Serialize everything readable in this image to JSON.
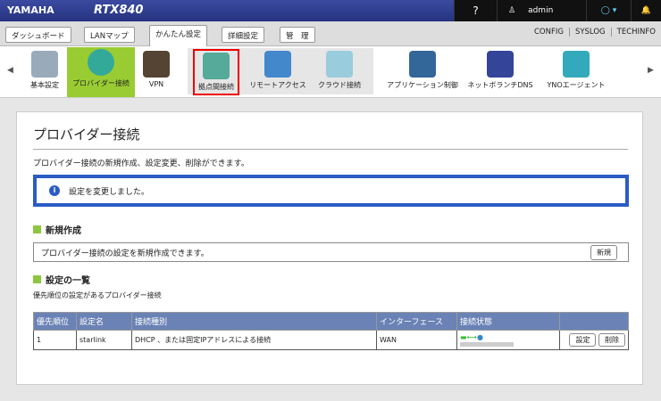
{
  "header": {
    "brand": "YAMAHA",
    "model": "RTX840",
    "help": "?",
    "user": "admin"
  },
  "tabs": [
    {
      "label": "ダッシュボード"
    },
    {
      "label": "LANマップ"
    },
    {
      "label": "かんたん設定"
    },
    {
      "label": "詳細設定"
    },
    {
      "label": "管　理"
    }
  ],
  "links": [
    "CONFIG",
    "SYSLOG",
    "TECHINFO"
  ],
  "menu": [
    {
      "label": "基本設定"
    },
    {
      "label": "プロバイダー接続"
    },
    {
      "label": "VPN"
    },
    {
      "label": "拠点間接続"
    },
    {
      "label": "リモートアクセス"
    },
    {
      "label": "クラウド接続"
    },
    {
      "label": "アプリケーション制御"
    },
    {
      "label": "ネットボランチDNS"
    },
    {
      "label": "YNOエージェント"
    }
  ],
  "page": {
    "title": "プロバイダー接続",
    "description": "プロバイダー接続の新規作成、設定変更、削除ができます。",
    "notice": "設定を変更しました。",
    "new_section": {
      "heading": "新規作成",
      "text": "プロバイダー接続の設定を新規作成できます。",
      "button": "新規"
    },
    "list_section": {
      "heading": "設定の一覧",
      "text": "優先順位の設定があるプロバイダー接続",
      "columns": [
        "優先順位",
        "設定名",
        "接続種別",
        "インターフェース",
        "接続状態",
        ""
      ],
      "rows": [
        {
          "priority": "1",
          "name": "starlink",
          "type": "DHCP 、または固定IPアドレスによる接続",
          "interface": "WAN",
          "edit": "設定",
          "delete": "削除"
        }
      ]
    }
  }
}
